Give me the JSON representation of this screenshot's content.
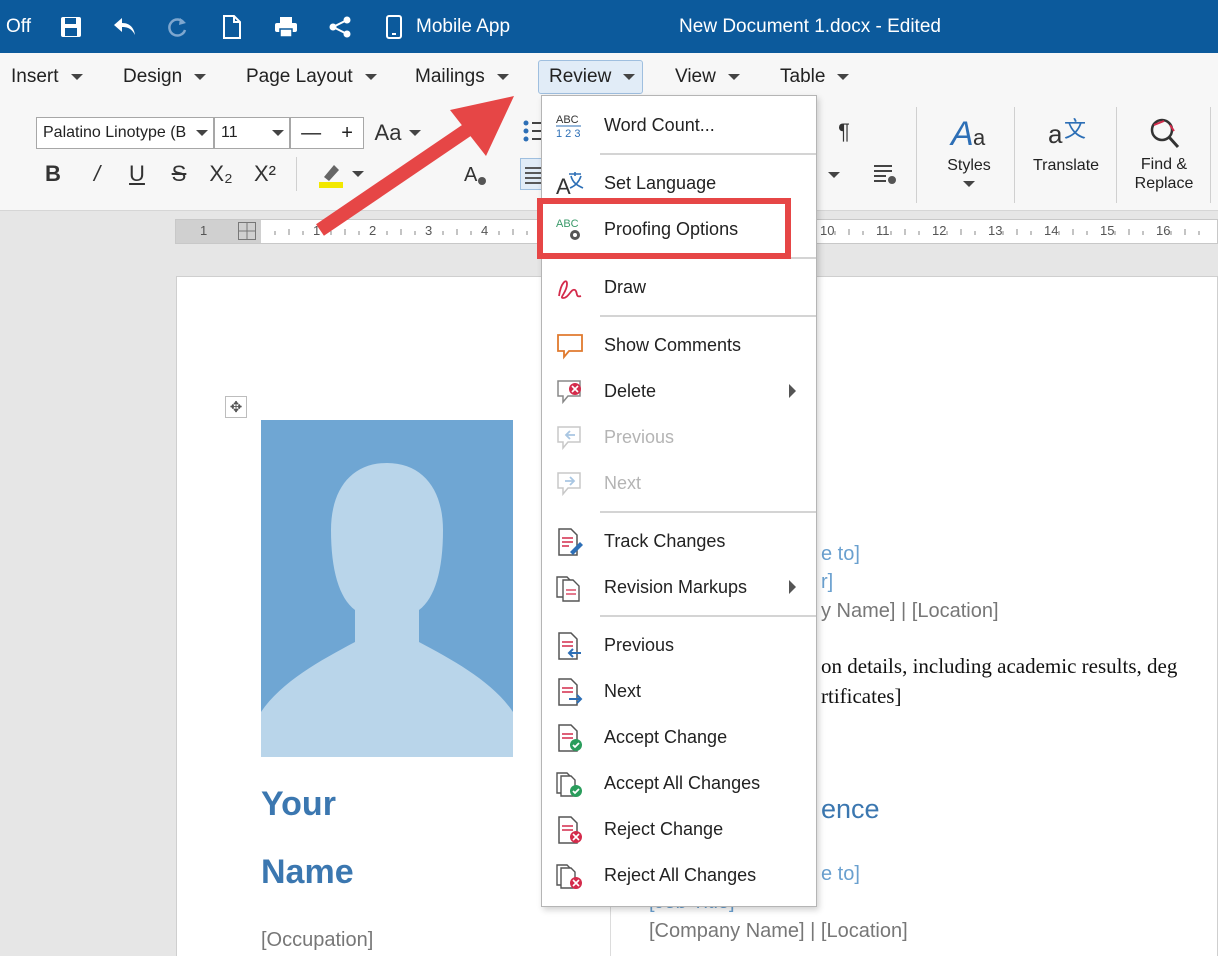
{
  "titlebar": {
    "autosave_label": "Off",
    "mobile_app_label": "Mobile App",
    "document_title": "New Document 1.docx - Edited"
  },
  "menubar": {
    "tabs": [
      {
        "label": "Insert"
      },
      {
        "label": "Design"
      },
      {
        "label": "Page Layout"
      },
      {
        "label": "Mailings"
      },
      {
        "label": "Review"
      },
      {
        "label": "View"
      },
      {
        "label": "Table"
      }
    ]
  },
  "ribbon": {
    "font_name": "Palatino Linotype (B",
    "font_size": "11",
    "minus": "—",
    "plus": "+",
    "change_case": "Aa",
    "bold": "B",
    "italic": "/",
    "underline": "U",
    "strikethrough": "S",
    "subscript": "X₂",
    "superscript": "X²",
    "pilcrow": "¶",
    "styles_label": "Styles",
    "translate_label": "Translate",
    "find_replace_label": "Find &\nReplace"
  },
  "ruler": {
    "numbers_left": [
      "1",
      "1",
      "2",
      "3",
      "4"
    ],
    "numbers_right": [
      "10",
      "11",
      "12",
      "13",
      "14",
      "15",
      "16"
    ]
  },
  "review_menu": {
    "items": [
      {
        "label": "Word Count...",
        "icon": "abc-123-icon"
      },
      {
        "label": "Set Language",
        "icon": "set-language-icon"
      },
      {
        "label": "Proofing Options",
        "icon": "proofing-gear-icon"
      },
      {
        "label": "Draw",
        "icon": "draw-pen-icon"
      },
      {
        "label": "Show Comments",
        "icon": "comment-icon"
      },
      {
        "label": "Delete",
        "icon": "delete-comment-icon"
      },
      {
        "label": "Previous",
        "icon": "previous-comment-icon"
      },
      {
        "label": "Next",
        "icon": "next-comment-icon"
      },
      {
        "label": "Track Changes",
        "icon": "track-changes-icon"
      },
      {
        "label": "Revision Markups",
        "icon": "revision-markups-icon"
      },
      {
        "label": "Previous",
        "icon": "previous-change-icon"
      },
      {
        "label": "Next",
        "icon": "next-change-icon"
      },
      {
        "label": "Accept Change",
        "icon": "accept-change-icon"
      },
      {
        "label": "Accept All Changes",
        "icon": "accept-all-icon"
      },
      {
        "label": "Reject Change",
        "icon": "reject-change-icon"
      },
      {
        "label": "Reject All Changes",
        "icon": "reject-all-icon"
      }
    ]
  },
  "document": {
    "name_line1": "Your",
    "name_line2": "Name",
    "occupation": "[Occupation]",
    "date_fragment_1": "e to]",
    "title_fragment_1": "r]",
    "company_fragment_1": "y Name] | [Location]",
    "education_line1": "on details, including academic results, deg",
    "education_line2": "rtificates]",
    "section_heading": "ence",
    "date_fragment_2": "e to]",
    "job_title_fragment": "[Job Title]",
    "company_line_2": "[Company Name] | [Location]"
  },
  "colors": {
    "titlebar_bg": "#0c5a9c",
    "accent_blue": "#3b77b0",
    "highlight_red": "#e64646"
  }
}
